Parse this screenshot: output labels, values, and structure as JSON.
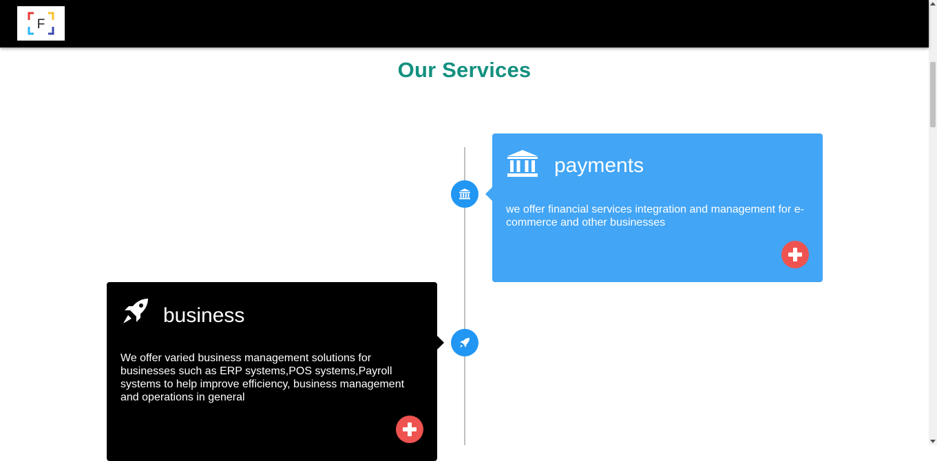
{
  "header": {
    "logo_icon": "F-logo-icon",
    "logo_letter": "F"
  },
  "page": {
    "title": "Our Services"
  },
  "services": [
    {
      "title": "payments",
      "icon": "bank-icon",
      "description": "we offer financial services integration and management for e-commerce and other businesses",
      "card_color": "#42a5f5",
      "action_icon": "plus-icon"
    },
    {
      "title": "business",
      "icon": "rocket-icon",
      "description": "We offer varied business management solutions for businesses such as ERP systems,POS systems,Payroll systems to help improve efficiency, business management and operations in general",
      "card_color": "#000000",
      "action_icon": "plus-icon"
    }
  ],
  "colors": {
    "title": "#13907f",
    "timeline_node": "#2196f3",
    "action_button": "#ef5350"
  }
}
